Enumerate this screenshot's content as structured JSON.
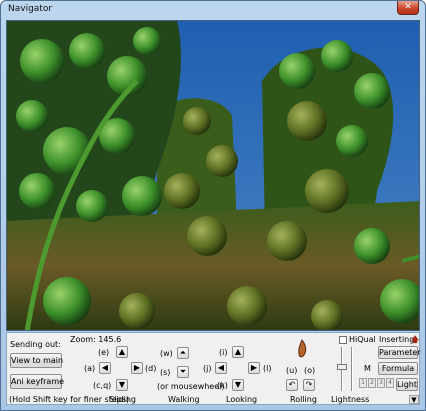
{
  "window": {
    "title": "Navigator",
    "close_glyph": "✕"
  },
  "viewport": {
    "description_icon": "fractal-render-icon"
  },
  "controls": {
    "sending_out_label": "Sending out:",
    "view_to_main": "View to main",
    "ani_keyframe": "Ani keyframe",
    "hold_shift_hint": "(Hold Shift key for finer steps)",
    "zoom_label": "Zoom: 145.6",
    "sliding": {
      "title": "Sliding",
      "up_key": "(e)",
      "left_key": "(a)",
      "right_key": "(d)",
      "down_key": "(c,q)"
    },
    "walking": {
      "title": "Walking",
      "forward_key": "(w)",
      "back_key": "(s)",
      "mousewheel": "(or mousewheel)"
    },
    "looking": {
      "title": "Looking",
      "up_key": "(i)",
      "left_key": "(j)",
      "right_key": "(l)",
      "down_key": "(k)"
    },
    "rolling": {
      "title": "Rolling",
      "left_key": "(u)",
      "right_key": "(o)"
    },
    "lightness": {
      "title": "Lightness",
      "m_label": "M",
      "hiqual_label": "HiQual"
    },
    "inserting_label": "Inserting:",
    "parameter": "Parameter",
    "formula": "Formula",
    "light": "Light",
    "mini_buttons": [
      "1",
      "2",
      "3",
      "4"
    ]
  },
  "colors": {
    "accent": "#c9452b",
    "sky": "#2a6ab8",
    "foliage": "#2f6f1e"
  }
}
